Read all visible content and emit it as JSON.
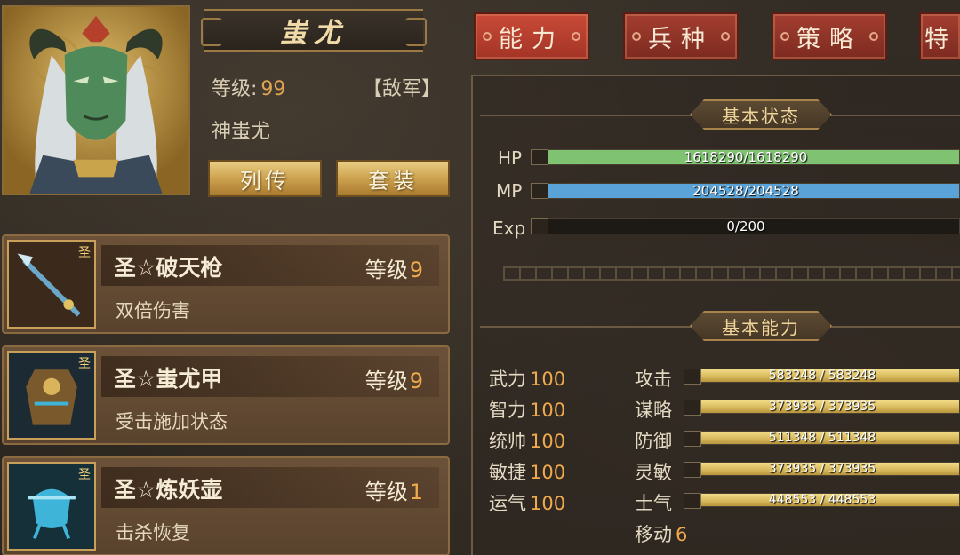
{
  "hero": {
    "name": "蚩尤",
    "level_label": "等级:",
    "level": "99",
    "faction": "【敌军】",
    "title": "神蚩尤",
    "buttons": {
      "biography": "列传",
      "set": "套装"
    }
  },
  "equipment": [
    {
      "name": "圣☆破天枪",
      "level_label": "等级",
      "level": "9",
      "desc": "双倍伤害",
      "badge": "圣",
      "icon": "spear-icon"
    },
    {
      "name": "圣☆蚩尤甲",
      "level_label": "等级",
      "level": "9",
      "desc": "受击施加状态",
      "badge": "圣",
      "icon": "armor-icon"
    },
    {
      "name": "圣☆炼妖壶",
      "level_label": "等级",
      "level": "1",
      "desc": "击杀恢复",
      "badge": "圣",
      "icon": "cauldron-icon"
    }
  ],
  "tabs": [
    "能力",
    "兵种",
    "策略",
    "特"
  ],
  "active_tab": "能力",
  "basic_status": {
    "title": "基本状态",
    "hp": {
      "label": "HP",
      "text": "1618290/1618290",
      "fill": 1.0,
      "color": "#7fc272"
    },
    "mp": {
      "label": "MP",
      "text": "204528/204528",
      "fill": 1.0,
      "color": "#5aa3d8"
    },
    "exp": {
      "label": "Exp",
      "text": "0/200",
      "fill": 0.0,
      "color": "#c9a54a"
    }
  },
  "basic_ability": {
    "title": "基本能力",
    "attributes": [
      {
        "label": "武力",
        "value": "100"
      },
      {
        "label": "智力",
        "value": "100"
      },
      {
        "label": "统帅",
        "value": "100"
      },
      {
        "label": "敏捷",
        "value": "100"
      },
      {
        "label": "运气",
        "value": "100"
      }
    ],
    "combat": [
      {
        "label": "攻击",
        "text": "583248 / 583248",
        "fill": 1.0
      },
      {
        "label": "谋略",
        "text": "373935 / 373935",
        "fill": 1.0
      },
      {
        "label": "防御",
        "text": "511348 / 511348",
        "fill": 1.0
      },
      {
        "label": "灵敏",
        "text": "373935 / 373935",
        "fill": 1.0
      },
      {
        "label": "士气",
        "text": "448553 / 448553",
        "fill": 1.0
      }
    ],
    "move": {
      "label": "移动",
      "value": "6"
    }
  }
}
